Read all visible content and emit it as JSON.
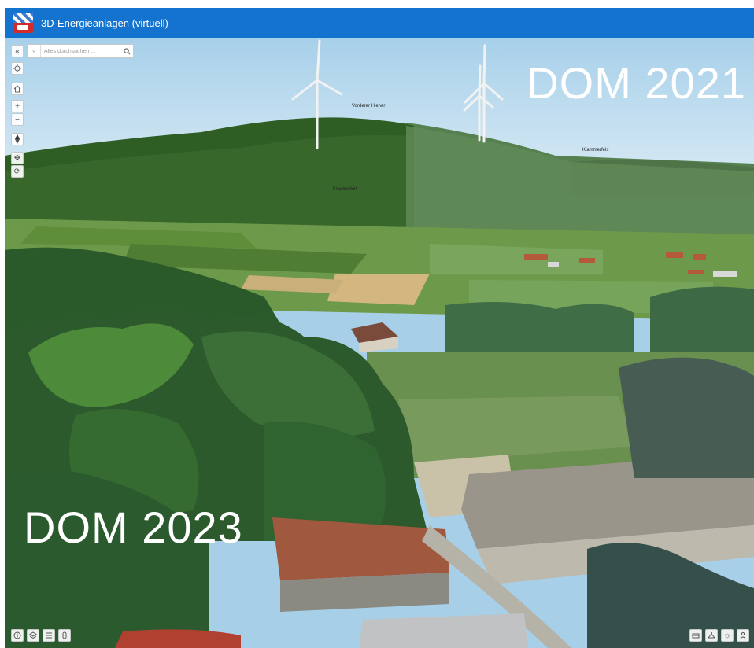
{
  "header": {
    "title": "3D-Energieanlagen (virtuell)",
    "logo": "district-coat-of-arms",
    "background": "#1473cf"
  },
  "search": {
    "placeholder": "Alles durchsuchen ..."
  },
  "overlay": {
    "left_label": "DOM 2023",
    "right_label": "DOM 2021"
  },
  "map_labels": {
    "vorderer_hiener": "Vorderer Hiener",
    "friedendorf": "Friedendorf",
    "klammerfels": "Klammerfels"
  },
  "toolbar_left": [
    "collapse-icon",
    "locate-icon",
    "home-icon",
    "zoom-in-icon",
    "zoom-out-icon",
    "compass-icon",
    "pan-icon",
    "rotate-icon"
  ],
  "toolbar_bottom_left": [
    "info-icon",
    "layers-icon",
    "legend-icon",
    "touch-icon"
  ],
  "toolbar_bottom_right": [
    "scene-icon",
    "daylight-icon",
    "sun-icon",
    "share-icon"
  ]
}
